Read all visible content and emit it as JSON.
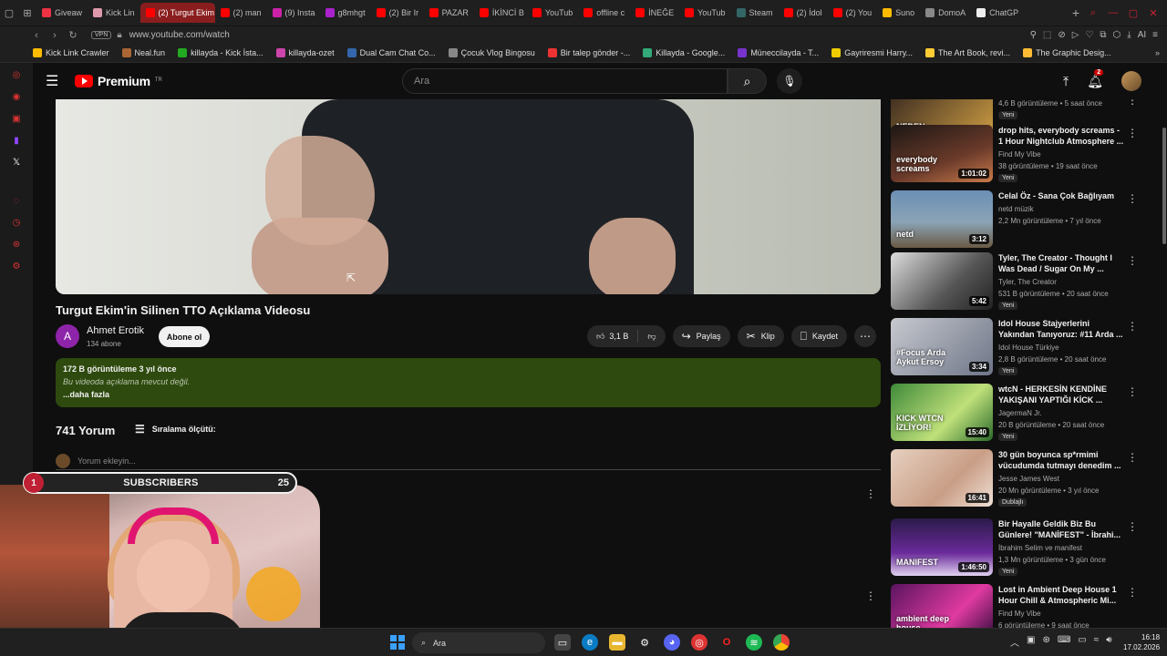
{
  "browser": {
    "tabs": [
      "Giveaw",
      "Kick Lin",
      "(2) Turgut Ekim",
      "(2) man",
      "(9) Insta",
      "g8mhgt",
      "(2) Bir Ir",
      "PAZAR",
      "İKİNCİ B",
      "YouTub",
      "offline c",
      "İNEĞE",
      "YouTub",
      "Steam",
      "(2) İdol",
      "(2) You",
      "Suno",
      "DomoA",
      "ChatGP"
    ],
    "active_tab": 2,
    "url": "www.youtube.com/watch",
    "vpn_label": "VPN",
    "bookmarks": [
      "Kick Link Crawler",
      "Neal.fun",
      "killayda - Kick İsta...",
      "killayda-ozet",
      "Dual Cam Chat Co...",
      "Çocuk Vlog Bingosu",
      "Bir talep gönder -...",
      "Killayda - Google...",
      "Müneccilayda - T...",
      "Gayriresmi Harry...",
      "The Art Book, revi...",
      "The Graphic Desig..."
    ]
  },
  "header": {
    "logo_text": "Premium",
    "logo_region": "TR",
    "search_placeholder": "Ara",
    "notif_count": "2"
  },
  "video": {
    "title": "Turgut Ekim'in Silinen TTO Açıklama Videosu",
    "channel": "Ahmet Erotik",
    "channel_initial": "A",
    "subs": "134 abone",
    "subscribe_label": "Abone ol",
    "likes": "3,1 B",
    "share_label": "Paylaş",
    "clip_label": "Klip",
    "save_label": "Kaydet"
  },
  "description": {
    "meta": "172 B görüntüleme  3 yıl önce",
    "text": "Bu videoda açıklama mevcut değil.",
    "more": "...daha fazla"
  },
  "comments": {
    "count": "741 Yorum",
    "sort_label": "Sıralama ölçütü:",
    "add_placeholder": "Yorum ekleyin..."
  },
  "overlay": {
    "sub_number": "1",
    "sub_label": "SUBSCRIBERS",
    "sub_goal": "25"
  },
  "sidebar": [
    {
      "title": "",
      "channel": "",
      "views": "4,6 B görüntüleme • 5 saat önce",
      "badge": "Yeni",
      "duration": "31:51",
      "thumb_text": "NEDEN DABİLDİ?"
    },
    {
      "title": "drop hits, everybody screams - 1 Hour Nightclub Atmosphere ...",
      "channel": "Find My Vibe",
      "views": "38 görüntüleme • 19 saat önce",
      "badge": "Yeni",
      "duration": "1:01:02",
      "thumb_text": "everybody screams"
    },
    {
      "title": "Celal Öz - Sana Çok Bağlıyam",
      "channel": "netd müzik",
      "views": "2,2 Mn görüntüleme • 7 yıl önce",
      "badge": "",
      "duration": "3:12",
      "thumb_text": "netd"
    },
    {
      "title": "Tyler, The Creator - Thought I Was Dead / Sugar On My ...",
      "channel": "Tyler, The Creator",
      "views": "531 B görüntüleme • 20 saat önce",
      "badge": "Yeni",
      "duration": "5:42",
      "thumb_text": ""
    },
    {
      "title": "Idol House Stajyerlerini Yakından Tanıyoruz: #11 Arda ...",
      "channel": "Idol House Türkiye",
      "views": "2,8 B görüntüleme • 20 saat önce",
      "badge": "Yeni",
      "duration": "3:34",
      "thumb_text": "#Focus Arda Aykut Ersoy"
    },
    {
      "title": "wtcN - HERKESİN KENDİNE YAKIŞANI YAPTIĞI KİCK ...",
      "channel": "JagermaN Jr.",
      "views": "20 B görüntüleme • 20 saat önce",
      "badge": "Yeni",
      "duration": "15:40",
      "thumb_text": "KICK WTCN İZLİYOR!"
    },
    {
      "title": "30 gün boyunca sp*rmimi vücudumda tutmayı denedim ...",
      "channel": "Jesse James West",
      "views": "20 Mn görüntüleme • 3 yıl önce",
      "badge": "Dublajlı",
      "duration": "16:41",
      "thumb_text": ""
    },
    {
      "title": "Bir Hayalle Geldik Biz Bu Günlere! \"MANİFEST\" - İbrahi...",
      "channel": "İbrahim Selim  ve manifest",
      "views": "1,3 Mn görüntüleme • 3 gün önce",
      "badge": "Yeni",
      "duration": "1:46:50",
      "thumb_text": "MANIFEST"
    },
    {
      "title": "Lost in Ambient Deep House 1 Hour Chill & Atmospheric Mi...",
      "channel": "Find My Vibe",
      "views": "6 görüntüleme • 9 saat önce",
      "badge": "",
      "duration": "",
      "thumb_text": "ambient deep house"
    }
  ],
  "taskbar": {
    "search_label": "Ara",
    "time": "16:18",
    "date": "17.02.2026"
  }
}
